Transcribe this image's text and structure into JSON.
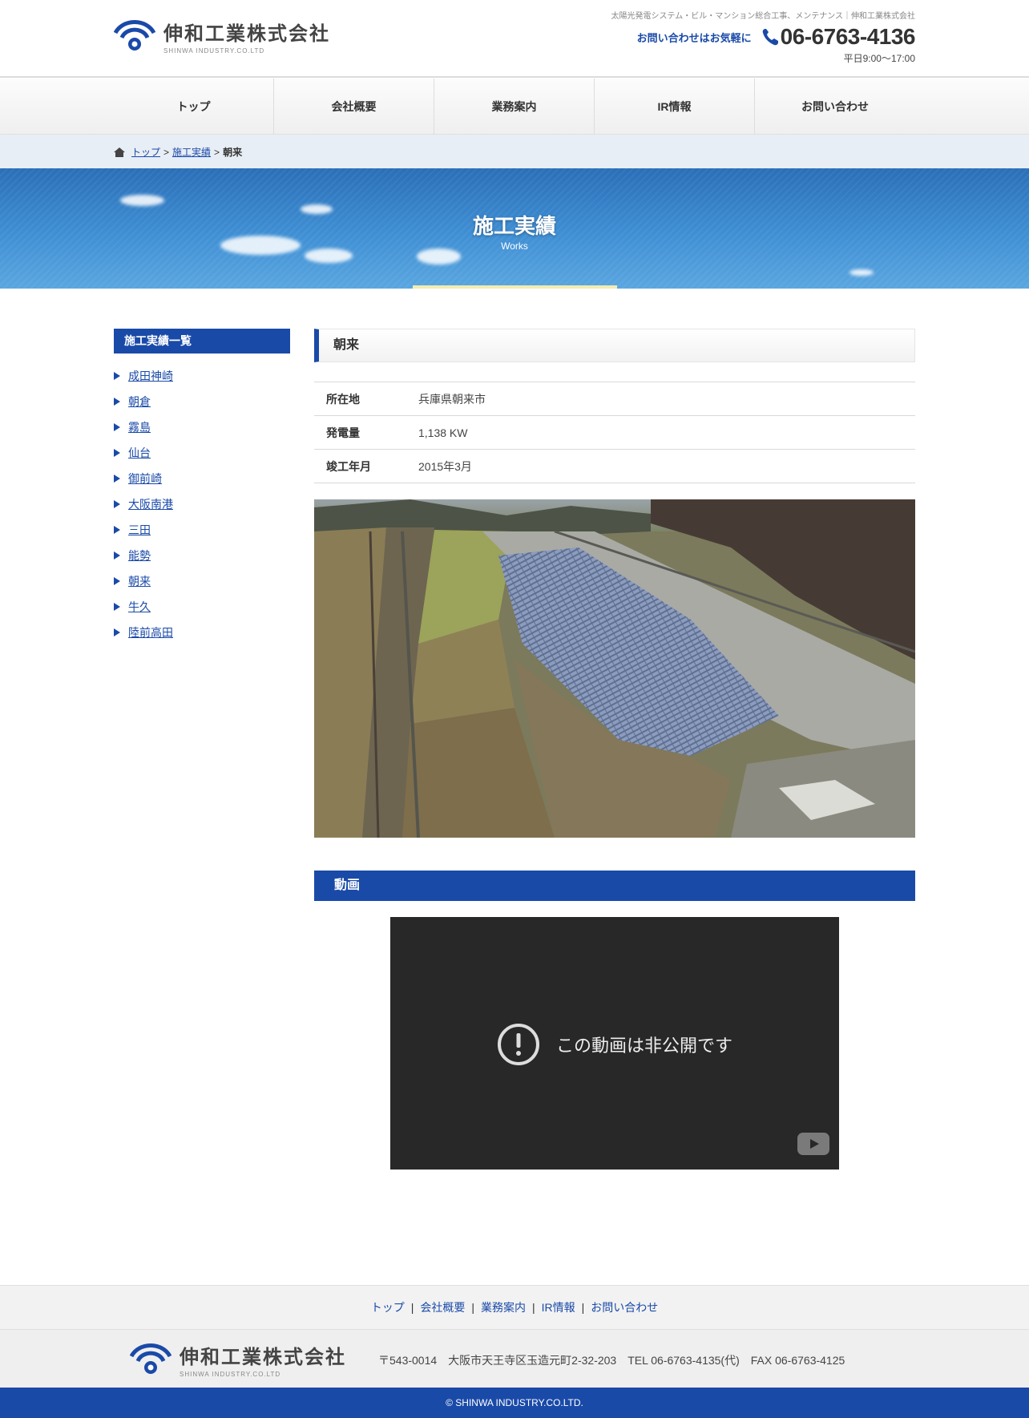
{
  "header": {
    "logo_name": "伸和工業株式会社",
    "logo_sub": "SHINWA INDUSTRY.CO.LTD",
    "tagline": "太陽光発電システム・ビル・マンション総合工事、メンテナンス｜伸和工業株式会社",
    "contact_label": "お問い合わせはお気軽に",
    "phone": "06-6763-4136",
    "hours": "平日9:00～17:00"
  },
  "nav": {
    "items": [
      {
        "label": "トップ"
      },
      {
        "label": "会社概要"
      },
      {
        "label": "業務案内"
      },
      {
        "label": "IR情報"
      },
      {
        "label": "お問い合わせ"
      }
    ]
  },
  "breadcrumb": {
    "top": "トップ",
    "sep1": ">",
    "works": "施工実績",
    "sep2": ">",
    "current": "朝来"
  },
  "hero": {
    "title": "施工実績",
    "subtitle": "Works"
  },
  "sidebar": {
    "heading": "施工実績一覧",
    "items": [
      {
        "label": "成田神崎"
      },
      {
        "label": "朝倉"
      },
      {
        "label": "霧島"
      },
      {
        "label": "仙台"
      },
      {
        "label": "御前崎"
      },
      {
        "label": "大阪南港"
      },
      {
        "label": "三田"
      },
      {
        "label": "能勢"
      },
      {
        "label": "朝来"
      },
      {
        "label": "牛久"
      },
      {
        "label": "陸前高田"
      }
    ]
  },
  "main": {
    "title": "朝来",
    "specs": [
      {
        "label": "所在地",
        "value": "兵庫県朝来市"
      },
      {
        "label": "発電量",
        "value": "1,138 KW"
      },
      {
        "label": "竣工年月",
        "value": "2015年3月"
      }
    ],
    "video_heading": "動画",
    "video_message": "この動画は非公開です"
  },
  "footer": {
    "nav": [
      {
        "label": "トップ"
      },
      {
        "label": "会社概要"
      },
      {
        "label": "業務案内"
      },
      {
        "label": "IR情報"
      },
      {
        "label": "お問い合わせ"
      }
    ],
    "separator": "|",
    "logo_name": "伸和工業株式会社",
    "logo_sub": "SHINWA INDUSTRY.CO.LTD",
    "address": "〒543-0014　大阪市天王寺区玉造元町2-32-203　TEL 06-6763-4135(代)　FAX 06-6763-4125",
    "copyright": "© SHINWA INDUSTRY.CO.LTD."
  },
  "colors": {
    "brand_blue": "#1a4aa8",
    "hero_sky": "#3f8fd4",
    "hero_accent_bar": "#f3ecb0"
  },
  "icons": [
    "company-logo-icon",
    "phone-icon",
    "home-icon",
    "warning-icon",
    "youtube-icon"
  ]
}
